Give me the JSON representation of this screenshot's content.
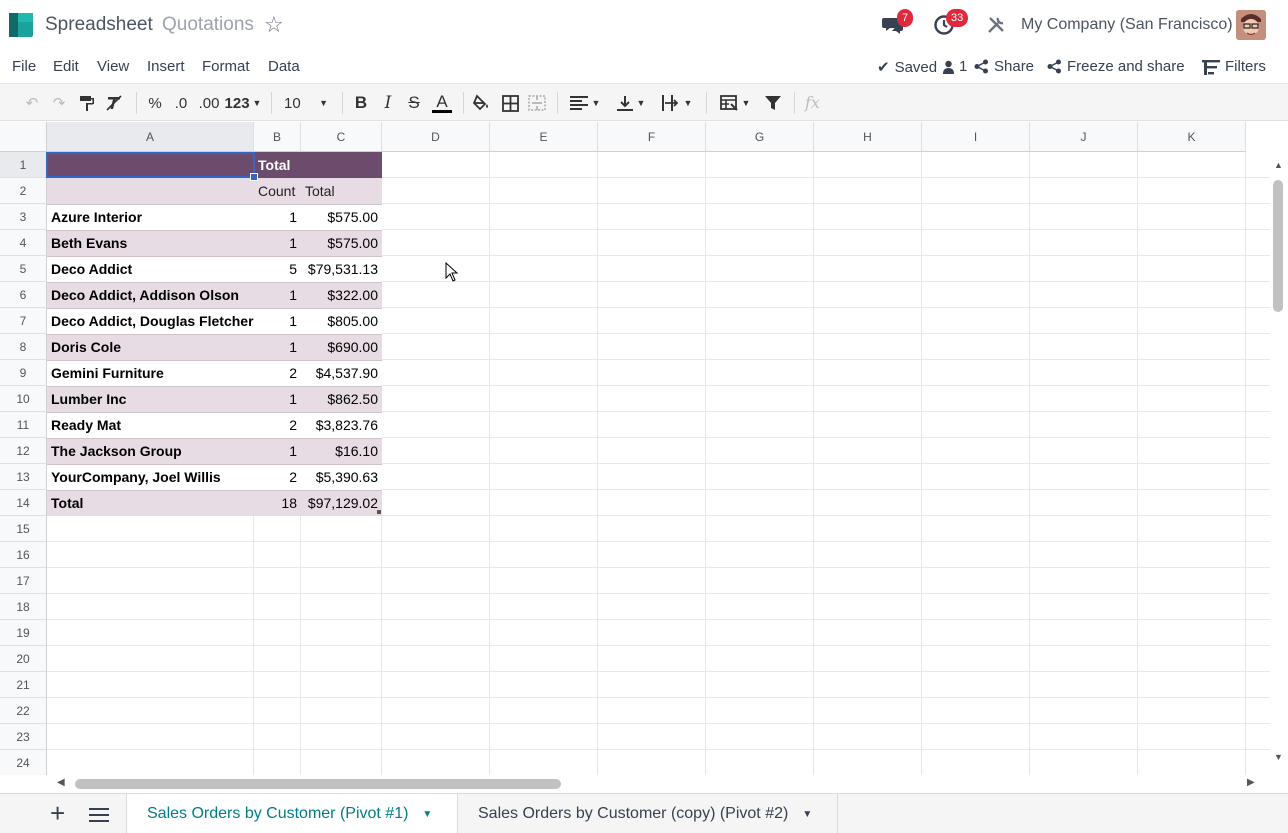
{
  "header": {
    "app_title": "Spreadsheet",
    "document_title": "Quotations",
    "messages_count": "7",
    "activities_count": "33",
    "company": "My Company (San Francisco)"
  },
  "menu": {
    "items": [
      "File",
      "Edit",
      "View",
      "Insert",
      "Format",
      "Data"
    ],
    "saved_label": "Saved",
    "users_count": "1",
    "share_label": "Share",
    "freeze_share_label": "Freeze and share",
    "filters_label": "Filters"
  },
  "toolbar": {
    "percent": "%",
    "dec_decrease": ".0",
    "dec_increase": ".00",
    "more_formats": "123",
    "font_size": "10",
    "bold": "B",
    "italic": "I",
    "strike": "S",
    "text_color": "A",
    "formula_label": "fx"
  },
  "grid": {
    "columns": [
      "A",
      "B",
      "C",
      "D",
      "E",
      "F",
      "G",
      "H",
      "I",
      "J",
      "K"
    ],
    "rows": [
      "1",
      "2",
      "3",
      "4",
      "5",
      "6",
      "7",
      "8",
      "9",
      "10",
      "11",
      "12",
      "13",
      "14",
      "15",
      "16",
      "17",
      "18",
      "19",
      "20",
      "21",
      "22",
      "23",
      "24"
    ],
    "pivot_header": "Total",
    "measure_count": "Count",
    "measure_total": "Total",
    "pivot_rows": [
      {
        "name": "Azure Interior",
        "count": "1",
        "total": "$575.00"
      },
      {
        "name": "Beth Evans",
        "count": "1",
        "total": "$575.00"
      },
      {
        "name": "Deco Addict",
        "count": "5",
        "total": "$79,531.13"
      },
      {
        "name": "Deco Addict, Addison Olson",
        "count": "1",
        "total": "$322.00"
      },
      {
        "name": "Deco Addict, Douglas Fletcher",
        "count": "1",
        "total": "$805.00"
      },
      {
        "name": "Doris Cole",
        "count": "1",
        "total": "$690.00"
      },
      {
        "name": "Gemini Furniture",
        "count": "2",
        "total": "$4,537.90"
      },
      {
        "name": "Lumber Inc",
        "count": "1",
        "total": "$862.50"
      },
      {
        "name": "Ready Mat",
        "count": "2",
        "total": "$3,823.76"
      },
      {
        "name": "The Jackson Group",
        "count": "1",
        "total": "$16.10"
      },
      {
        "name": "YourCompany, Joel Willis",
        "count": "2",
        "total": "$5,390.63"
      }
    ],
    "grand_total": {
      "name": "Total",
      "count": "18",
      "total": "$97,129.02"
    }
  },
  "sheets": [
    {
      "label": "Sales Orders by Customer (Pivot #1)",
      "active": true
    },
    {
      "label": "Sales Orders by Customer (copy) (Pivot #2)",
      "active": false
    }
  ],
  "colors": {
    "pivot_header": "#6c4c6c",
    "pivot_band": "#e7dce4",
    "accent": "#017e84",
    "badge": "#e0293b"
  }
}
